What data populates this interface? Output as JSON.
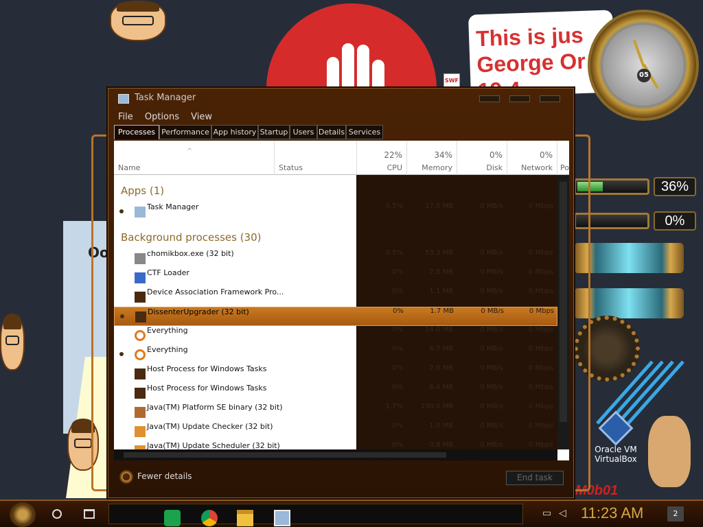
{
  "desktop": {
    "note_lines": [
      "This is jus",
      "George Or",
      "19 4"
    ],
    "clock_number": "05",
    "panel_text": "Oo",
    "gauges": [
      {
        "label": "36%",
        "value": 0.36
      },
      {
        "label": "0%",
        "value": 0.0
      }
    ],
    "virtualbox_label_1": "Oracle VM",
    "virtualbox_label_2": "VirtualBox",
    "brand_text": "M0b01",
    "swf_label": "SWF"
  },
  "window": {
    "title": "Task Manager",
    "menu": [
      "File",
      "Options",
      "View"
    ],
    "tabs": [
      {
        "label": "Processes",
        "active": true
      },
      {
        "label": "Performance",
        "active": false
      },
      {
        "label": "App history",
        "active": false
      },
      {
        "label": "Startup",
        "active": false
      },
      {
        "label": "Users",
        "active": false
      },
      {
        "label": "Details",
        "active": false
      },
      {
        "label": "Services",
        "active": false
      }
    ],
    "columns": {
      "name": "Name",
      "status": "Status",
      "cpu_pct": "22%",
      "cpu": "CPU",
      "memory_pct": "34%",
      "memory": "Memory",
      "disk_pct": "0%",
      "disk": "Disk",
      "network_pct": "0%",
      "network": "Network",
      "power": "Po"
    },
    "groups": {
      "apps": "Apps (1)",
      "background": "Background processes (30)"
    },
    "apps": [
      {
        "name": "Task Manager",
        "cpu": "0.5%",
        "memory": "17.0 MB",
        "disk": "0 MB/s",
        "network": "0 Mbps",
        "icon": "task-manager-icon",
        "expandable": true
      }
    ],
    "processes": [
      {
        "name": "chomikbox.exe (32 bit)",
        "cpu": "0.5%",
        "memory": "53.3 MB",
        "disk": "0 MB/s",
        "network": "0 Mbps",
        "icon": "app-icon",
        "expandable": false
      },
      {
        "name": "CTF Loader",
        "cpu": "0%",
        "memory": "2.5 MB",
        "disk": "0 MB/s",
        "network": "0 Mbps",
        "icon": "ctf-loader-icon",
        "expandable": false
      },
      {
        "name": "Device Association Framework Pro...",
        "cpu": "0%",
        "memory": "1.1 MB",
        "disk": "0 MB/s",
        "network": "0 Mbps",
        "icon": "service-icon",
        "expandable": false
      },
      {
        "name": "DissenterUpgrader (32 bit)",
        "cpu": "0%",
        "memory": "1.7 MB",
        "disk": "0 MB/s",
        "network": "0 Mbps",
        "icon": "service-icon",
        "expandable": true,
        "selected": true
      },
      {
        "name": "Everything",
        "cpu": "0%",
        "memory": "14.0 MB",
        "disk": "0 MB/s",
        "network": "0 Mbps",
        "icon": "everything-icon",
        "expandable": false
      },
      {
        "name": "Everything",
        "cpu": "0%",
        "memory": "6.7 MB",
        "disk": "0 MB/s",
        "network": "0 Mbps",
        "icon": "everything-icon",
        "expandable": true
      },
      {
        "name": "Host Process for Windows Tasks",
        "cpu": "0%",
        "memory": "2.0 MB",
        "disk": "0 MB/s",
        "network": "0 Mbps",
        "icon": "service-icon",
        "expandable": false
      },
      {
        "name": "Host Process for Windows Tasks",
        "cpu": "0%",
        "memory": "6.4 MB",
        "disk": "0 MB/s",
        "network": "0 Mbps",
        "icon": "service-icon",
        "expandable": false
      },
      {
        "name": "Java(TM) Platform SE binary (32 bit)",
        "cpu": "1.7%",
        "memory": "190.0 MB",
        "disk": "0 MB/s",
        "network": "0 Mbps",
        "icon": "java-icon",
        "expandable": false
      },
      {
        "name": "Java(TM) Update Checker (32 bit)",
        "cpu": "0%",
        "memory": "1.0 MB",
        "disk": "0 MB/s",
        "network": "0 Mbps",
        "icon": "java-update-icon",
        "expandable": false
      },
      {
        "name": "Java(TM) Update Scheduler (32 bit)",
        "cpu": "0%",
        "memory": "0.8 MB",
        "disk": "0 MB/s",
        "network": "0 Mbps",
        "icon": "java-update-icon",
        "expandable": false
      }
    ],
    "footer": {
      "fewer_details": "Fewer details",
      "end_task": "End task"
    }
  },
  "taskbar": {
    "time": "11:23 AM",
    "notifications": "2",
    "pinned": [
      "spreadsheet-icon",
      "chrome-icon",
      "file-explorer-icon",
      "task-manager-icon"
    ]
  }
}
